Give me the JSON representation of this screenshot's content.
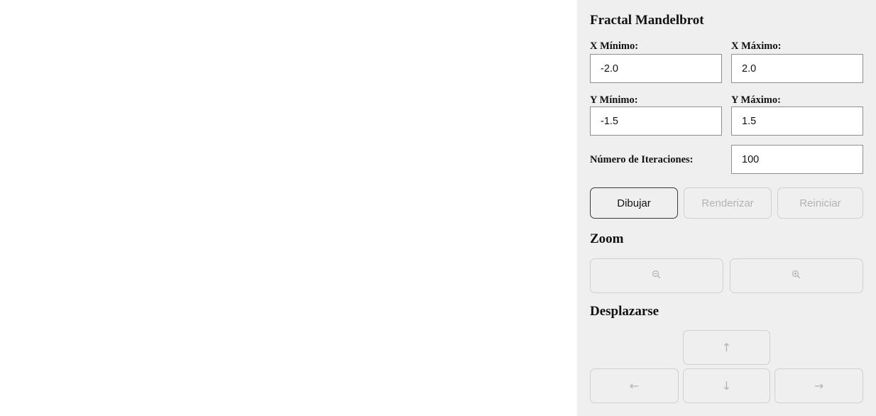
{
  "panel": {
    "title": "Fractal Mandelbrot",
    "fields": {
      "x_min": {
        "label": "X Mínimo:",
        "value": "-2.0"
      },
      "x_max": {
        "label": "X Máximo:",
        "value": "2.0"
      },
      "y_min": {
        "label": "Y Mínimo:",
        "value": "-1.5"
      },
      "y_max": {
        "label": "Y Máximo:",
        "value": "1.5"
      },
      "iterations": {
        "label": "Número de Iteraciones:",
        "value": "100"
      }
    },
    "buttons": {
      "draw": "Dibujar",
      "render": "Renderizar",
      "reset": "Reiniciar"
    },
    "zoom": {
      "title": "Zoom",
      "zoom_out_icon": "zoom-out-icon",
      "zoom_in_icon": "zoom-in-icon"
    },
    "pan": {
      "title": "Desplazarse",
      "up_icon": "arrow-up-icon",
      "left_icon": "arrow-left-icon",
      "down_icon": "arrow-down-icon",
      "right_icon": "arrow-right-icon"
    }
  },
  "colors": {
    "panel_background": "#efefef",
    "canvas_background": "#ffffff",
    "disabled_text": "#b3b3b3",
    "active_border": "#3a3a3a"
  }
}
